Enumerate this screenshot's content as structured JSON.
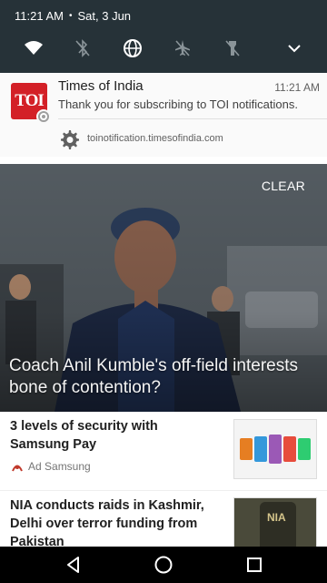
{
  "status_bar": {
    "time": "11:21 AM",
    "separator": "•",
    "date": "Sat, 3 Jun"
  },
  "quick_settings": [
    {
      "name": "wifi-icon",
      "state": "on"
    },
    {
      "name": "bluetooth-icon",
      "state": "off"
    },
    {
      "name": "globe-icon",
      "state": "on"
    },
    {
      "name": "airplane-icon",
      "state": "off"
    },
    {
      "name": "flashlight-icon",
      "state": "off"
    }
  ],
  "notification": {
    "logo_text": "TOI",
    "app_name": "Times of India",
    "time": "11:21 AM",
    "message": "Thank you for subscribing to TOI notifications.",
    "site": "toinotification.timesofindia.com"
  },
  "shade": {
    "clear_label": "CLEAR"
  },
  "hero": {
    "headline": "Coach Anil Kumble's off-field interests bone of contention?"
  },
  "articles": [
    {
      "title": "3 levels of security with Samsung Pay",
      "sponsor": "Ad Samsung"
    },
    {
      "title": "NIA conducts raids in Kashmir, Delhi over terror funding from Pakistan",
      "thumb_text": "NIA"
    }
  ],
  "colors": {
    "shade_bg": "#263238",
    "toi_red": "#d32027",
    "nav_bg": "#000000"
  }
}
